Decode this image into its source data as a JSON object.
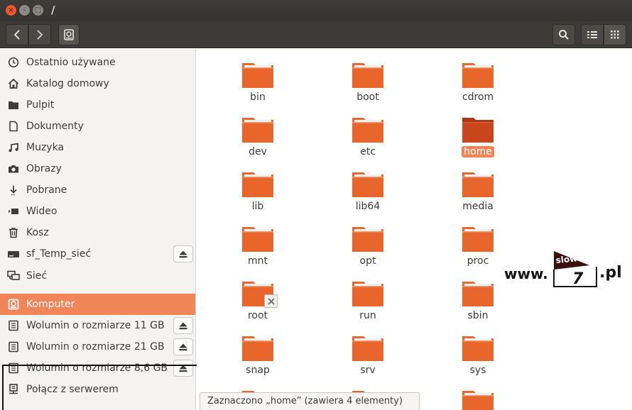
{
  "window": {
    "title": "/"
  },
  "toolbar": {
    "back": "‹",
    "forward": "›"
  },
  "sidebar": {
    "items": [
      {
        "label": "Ostatnio używane",
        "icon": "clock-icon"
      },
      {
        "label": "Katalog domowy",
        "icon": "home-icon"
      },
      {
        "label": "Pulpit",
        "icon": "desktop-folder-icon"
      },
      {
        "label": "Dokumenty",
        "icon": "document-icon"
      },
      {
        "label": "Muzyka",
        "icon": "music-icon"
      },
      {
        "label": "Obrazy",
        "icon": "camera-icon"
      },
      {
        "label": "Pobrane",
        "icon": "download-icon"
      },
      {
        "label": "Wideo",
        "icon": "video-icon"
      },
      {
        "label": "Kosz",
        "icon": "trash-icon"
      },
      {
        "label": "sf_Temp_sieć",
        "icon": "drive-icon",
        "eject": true
      },
      {
        "label": "Sieć",
        "icon": "network-icon"
      },
      {
        "label": "Komputer",
        "icon": "computer-icon",
        "active": true
      },
      {
        "label": "Wolumin o rozmiarze 11 GB",
        "icon": "volume-icon",
        "eject": true
      },
      {
        "label": "Wolumin o rozmiarze 21 GB",
        "icon": "volume-icon",
        "eject": true
      },
      {
        "label": "Wolumin o rozmiarze 8,6 GB",
        "icon": "volume-icon",
        "eject": true
      },
      {
        "label": "Połącz z serwerem",
        "icon": "server-icon"
      }
    ]
  },
  "folders": [
    {
      "name": "bin"
    },
    {
      "name": "boot"
    },
    {
      "name": "cdrom"
    },
    {
      "name": "dev"
    },
    {
      "name": "etc"
    },
    {
      "name": "home",
      "selected": true
    },
    {
      "name": "lib"
    },
    {
      "name": "lib64"
    },
    {
      "name": "media"
    },
    {
      "name": "mnt"
    },
    {
      "name": "opt"
    },
    {
      "name": "proc"
    },
    {
      "name": "root",
      "locked": true
    },
    {
      "name": "run"
    },
    {
      "name": "sbin"
    },
    {
      "name": "snap"
    },
    {
      "name": "srv"
    },
    {
      "name": "sys"
    },
    {
      "name": ""
    },
    {
      "name": ""
    },
    {
      "name": ""
    }
  ],
  "status": {
    "text": "Zaznaczono „home” (zawiera 4 elementy)"
  },
  "watermark": {
    "www": "www.",
    "logo_top": "slow",
    "logo_num": "7",
    "tld": ".pl"
  },
  "colors": {
    "accent": "#f08559",
    "folder": "#e8662b",
    "folder_selected": "#c9461c"
  }
}
